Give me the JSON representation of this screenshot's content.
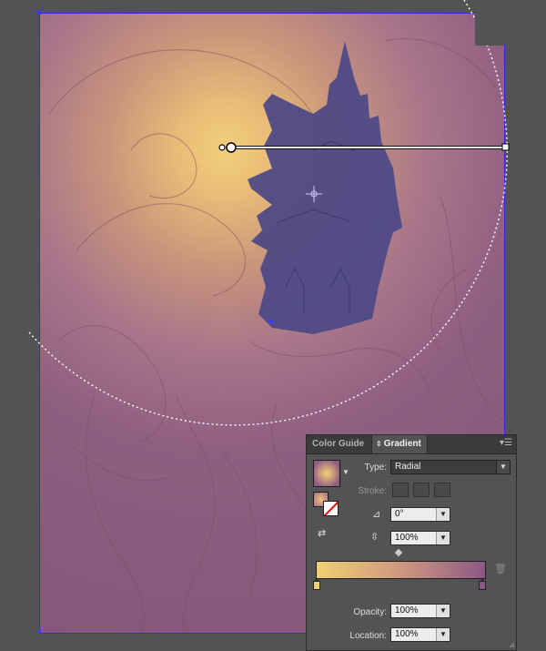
{
  "panel": {
    "tabs": [
      {
        "label": "Color Guide"
      },
      {
        "label": "Gradient"
      }
    ],
    "type_label": "Type:",
    "type_value": "Radial",
    "stroke_label": "Stroke:",
    "angle_value": "0°",
    "aspect_value": "100%",
    "opacity_label": "Opacity:",
    "opacity_value": "100%",
    "location_label": "Location:",
    "location_value": "100%",
    "gradient_colors": {
      "start": "#f2cf72",
      "end": "#8c5883"
    }
  },
  "icons": {
    "panel_menu": "panel-menu-icon",
    "angle": "angle-icon",
    "aspect_ratio": "aspect-ratio-icon",
    "reverse": "reverse-gradient-icon",
    "trash": "trash-icon",
    "crosshair": "crosshair-icon"
  },
  "colors": {
    "artboard_border": "#2f2fd6",
    "house": "#4e4a86",
    "workspace": "#535353"
  }
}
